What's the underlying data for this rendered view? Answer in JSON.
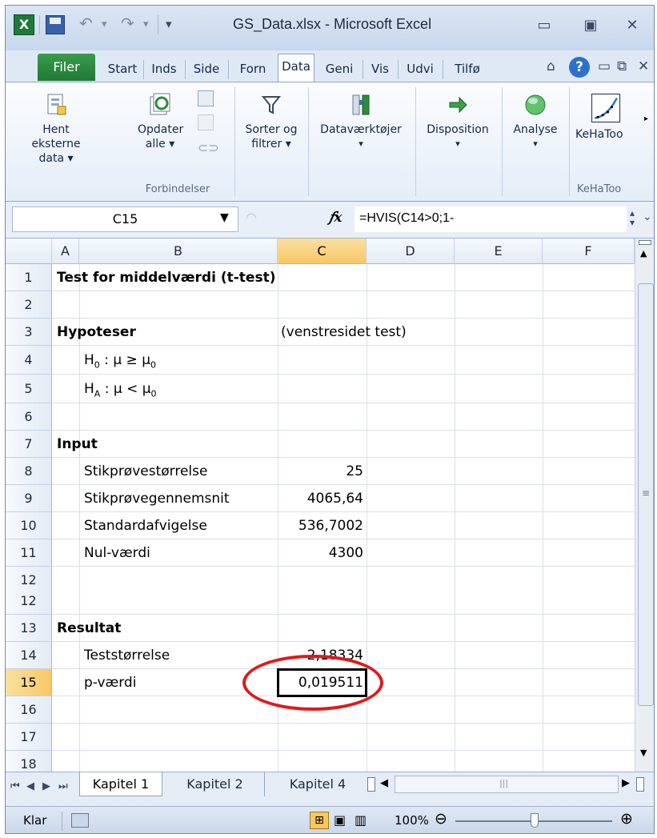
{
  "window": {
    "title": "GS_Data.xlsx - Microsoft Excel",
    "app_icon_letter": "X",
    "controls": {
      "minimize": "▭",
      "restore": "▣",
      "close": "✕"
    }
  },
  "ribbon_tabs": {
    "file": "Filer",
    "tabs": [
      "Start",
      "Inds",
      "Side",
      "Forn",
      "Data",
      "Geni",
      "Vis",
      "Udvi",
      "Tilfø"
    ],
    "active": "Data"
  },
  "ribbon": {
    "hent_eksterne": "Hent eksterne data ▾",
    "opdater": "Opdater alle ▾",
    "forbindelser_label": "Forbindelser",
    "sorter": "Sorter og filtrer ▾",
    "datavaerktojer": "Dataværktøjer",
    "disposition": "Disposition",
    "analyse": "Analyse",
    "kehatoo": "KeHaToo",
    "kehatoo_group": "KeHaToo"
  },
  "formula_bar": {
    "name_box": "C15",
    "fx": "fx",
    "formula": "=HVIS(C14>0;1-"
  },
  "columns": [
    "A",
    "B",
    "C",
    "D",
    "E",
    "F"
  ],
  "selected_column": "C",
  "rows": [
    "1",
    "2",
    "3",
    "4",
    "5",
    "6",
    "7",
    "8",
    "9",
    "10",
    "11",
    "12",
    "13",
    "14",
    "15",
    "16",
    "17",
    "18"
  ],
  "selected_row": "15",
  "cells": {
    "B1": "Test for middelværdi (t-test)",
    "B3": "Hypoteser",
    "C3": "(venstresidet test)",
    "B4_h": "H",
    "B4_sub": "0",
    "B4_rest": " : μ ≥ μ",
    "B4_sub2": "0",
    "B5_h": "H",
    "B5_sub": "A",
    "B5_rest": " : μ < μ",
    "B5_sub2": "0",
    "B7": "Input",
    "B8": "Stikprøvestørrelse",
    "C8": "25",
    "B9": "Stikprøvegennemsnit",
    "C9": "4065,64",
    "B10": "Standardafvigelse",
    "C10": "536,7002",
    "B11": "Nul-værdi",
    "C11": "4300",
    "B13": "Resultat",
    "B14": "Teststørrelse",
    "C14": "-2,18334",
    "B15": "p-værdi",
    "C15": "0,019511"
  },
  "sheet_tabs": [
    "Kapitel 1",
    "Kapitel 2",
    "Kapitel 4"
  ],
  "status": {
    "ready": "Klar",
    "zoom": "100%"
  },
  "colors": {
    "highlight_ellipse": "#e11919",
    "selected_header": "#f7c766",
    "file_tab": "#1f7a35"
  }
}
